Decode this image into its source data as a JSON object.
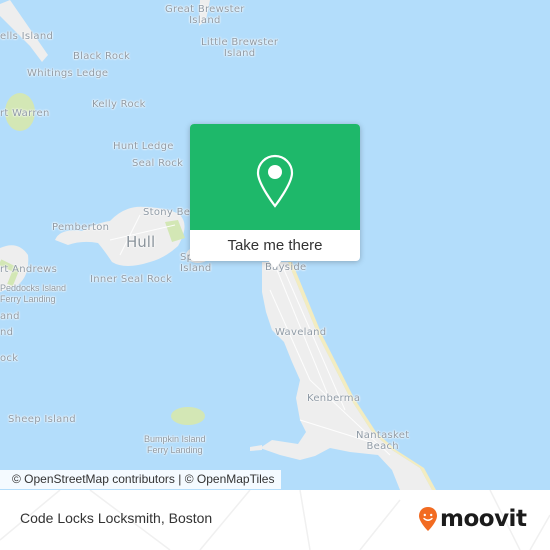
{
  "map": {
    "colors": {
      "water": "#b3ddfb",
      "land": "#eeeeee",
      "park": "#d3e7b5",
      "beach": "#f3ecc0",
      "label": "#8f9aa5"
    },
    "labels": {
      "great_brewster": "Great Brewster\nIsland",
      "little_brewster": "Little Brewster\nIsland",
      "lovells": "ells Island",
      "black_rock": "Black Rock",
      "whitings_ledge": "Whitings Ledge",
      "kelly_rock": "Kelly Rock",
      "fort_warren": "rt Warren",
      "hunt_ledge": "Hunt Ledge",
      "seal_rock": "Seal Rock",
      "stony_beach": "Stony Be",
      "pemberton": "Pemberton",
      "hull": "Hull",
      "spinnaker": "Sp\nIsland",
      "fort_andrews": "rt Andrews",
      "inner_seal_rock": "Inner Seal Rock",
      "peddocks_landing": "Peddocks Island\nFerry Landing",
      "island_a": "and",
      "island_b": "nd",
      "rock_partial": "ock",
      "bayside": "Bayside",
      "waveland": "Waveland",
      "kenberma": "Kenberma",
      "nantasket": "Nantasket\nBeach",
      "sheep_island": "Sheep Island",
      "bumpkin_landing": "Bumpkin Island\nFerry Landing"
    },
    "attribution": "© OpenStreetMap contributors | © OpenMapTiles"
  },
  "popup": {
    "icon": "map-pin-icon",
    "button_label": "Take me there",
    "color": "#1eb86a"
  },
  "footer": {
    "place_title": "Code Locks Locksmith, Boston",
    "brand": "moovit",
    "brand_color": "#f26b21"
  }
}
